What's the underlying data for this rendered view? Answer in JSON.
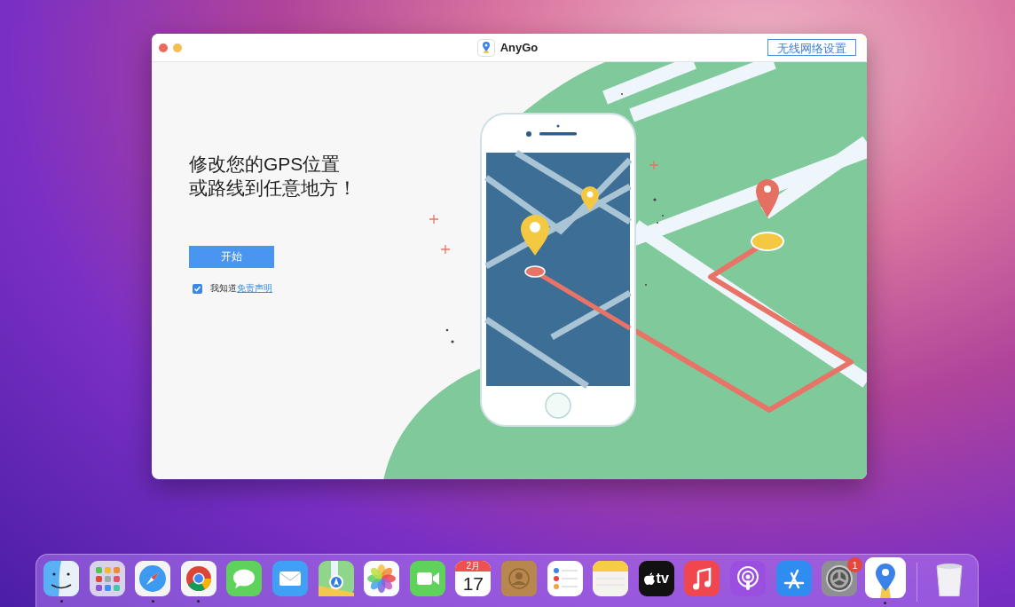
{
  "window": {
    "title": "AnyGo",
    "header_button": "无线网络设置"
  },
  "headline": [
    "修改您的GPS位置",
    "或路线到任意地方！"
  ],
  "start_button": "开始",
  "agreement": {
    "checked": true,
    "text": "我知道",
    "link": "免责声明"
  },
  "dock": [
    {
      "kind": "finder",
      "running": true
    },
    {
      "kind": "launchpad",
      "running": false
    },
    {
      "kind": "safari",
      "running": true
    },
    {
      "kind": "chrome",
      "running": true
    },
    {
      "kind": "messages",
      "running": false
    },
    {
      "kind": "mail",
      "running": false
    },
    {
      "kind": "maps",
      "running": false
    },
    {
      "kind": "photos",
      "running": false
    },
    {
      "kind": "facetime",
      "running": false
    },
    {
      "kind": "calendar",
      "month": "2月",
      "day": "17",
      "running": false
    },
    {
      "kind": "contacts",
      "running": false
    },
    {
      "kind": "reminders",
      "running": false
    },
    {
      "kind": "notes",
      "running": false
    },
    {
      "kind": "tv",
      "label": "tv",
      "running": false
    },
    {
      "kind": "music",
      "running": false
    },
    {
      "kind": "podcasts",
      "running": false
    },
    {
      "kind": "appstore",
      "running": false
    },
    {
      "kind": "settings",
      "badge": "1",
      "running": false
    },
    {
      "kind": "anygo",
      "running": true
    },
    {
      "kind": "divider"
    },
    {
      "kind": "trash",
      "running": false
    }
  ]
}
